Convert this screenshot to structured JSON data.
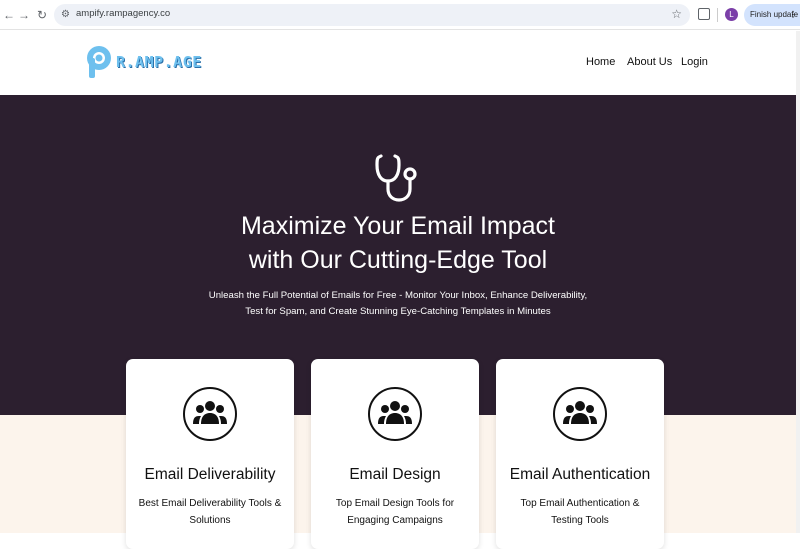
{
  "browser": {
    "url": "ampify.rampagency.co",
    "profile_initial": "L",
    "update_label": "Finish update"
  },
  "site": {
    "logo_text": "R.AMP.AGE",
    "nav": [
      "Home",
      "About Us",
      "Login"
    ]
  },
  "hero": {
    "icon": "stethoscope-icon",
    "title_line1": "Maximize Your Email Impact",
    "title_line2": "with Our Cutting-Edge Tool",
    "subtitle_line1": "Unleash the Full Potential of Emails for Free - Monitor Your Inbox, Enhance Deliverability,",
    "subtitle_line2": "Test for Spam, and Create Stunning Eye-Catching Templates in Minutes"
  },
  "cards": [
    {
      "icon": "users-group-icon",
      "title": "Email Deliverability",
      "sub_line1": "Best Email Deliverability Tools &",
      "sub_line2": "Solutions"
    },
    {
      "icon": "users-group-icon",
      "title": "Email Design",
      "sub_line1": "Top Email Design Tools for",
      "sub_line2": "Engaging Campaigns"
    },
    {
      "icon": "users-group-icon",
      "title": "Email Authentication",
      "sub_line1": "Top Email Authentication &",
      "sub_line2": "Testing Tools"
    }
  ],
  "colors": {
    "hero_bg": "#2c1f2f",
    "lower_bg": "#fcf4ec",
    "logo_blue": "#6ec0ee"
  }
}
